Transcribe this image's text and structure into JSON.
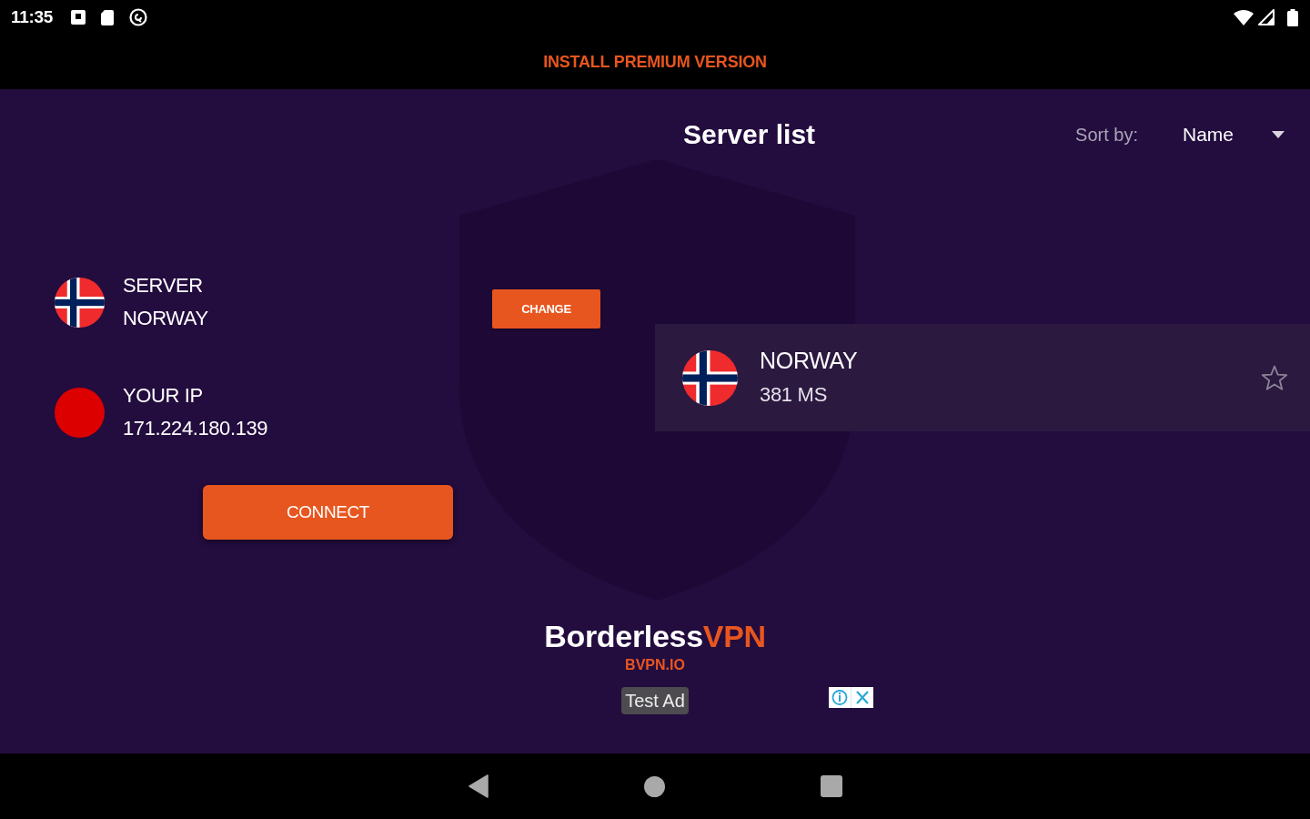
{
  "status_bar": {
    "time": "11:35"
  },
  "banner": {
    "text": "INSTALL PREMIUM VERSION"
  },
  "connection": {
    "server_label": "SERVER",
    "server_name": "NORWAY",
    "change_button": "CHANGE",
    "ip_label": "YOUR IP",
    "ip_address": "171.224.180.139",
    "connected": false,
    "connect_button": "CONNECT"
  },
  "server_list": {
    "title": "Server list",
    "sort_label": "Sort by:",
    "sort_value": "Name",
    "servers": [
      {
        "name": "NORWAY",
        "ping": "381 MS",
        "favorite": false
      }
    ]
  },
  "ad": {
    "logo": {
      "text": "Borderless",
      "accent": "VPN"
    },
    "url": "BVPN.IO",
    "badge": "Test Ad"
  }
}
